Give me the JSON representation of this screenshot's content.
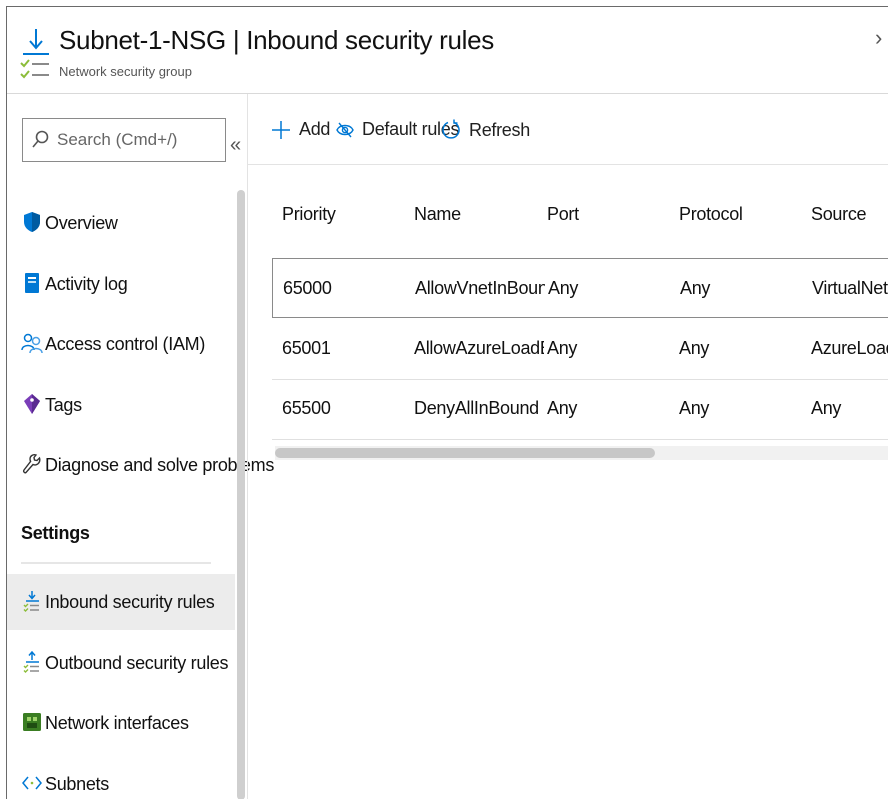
{
  "header": {
    "title": "Subnet-1-NSG | Inbound security rules",
    "subtitle": "Network security group",
    "icon": "inbound-rules-icon",
    "chevron": "›"
  },
  "sidebar": {
    "search_placeholder": "Search (Cmd+/)",
    "collapse_glyph": "«",
    "items": [
      {
        "label": "Overview",
        "icon": "shield-icon"
      },
      {
        "label": "Activity log",
        "icon": "book-icon"
      },
      {
        "label": "Access control (IAM)",
        "icon": "people-icon"
      },
      {
        "label": "Tags",
        "icon": "tag-icon"
      },
      {
        "label": "Diagnose and solve problems",
        "icon": "wrench-icon"
      }
    ],
    "section_title": "Settings",
    "settings_items": [
      {
        "label": "Inbound security rules",
        "icon": "inbound-rules-icon",
        "active": true
      },
      {
        "label": "Outbound security rules",
        "icon": "outbound-rules-icon",
        "active": false
      },
      {
        "label": "Network interfaces",
        "icon": "network-interface-icon",
        "active": false
      },
      {
        "label": "Subnets",
        "icon": "subnet-icon",
        "active": false
      }
    ]
  },
  "toolbar": {
    "add_label": "Add",
    "default_rules_label": "Default rules",
    "refresh_label": "Refresh"
  },
  "table": {
    "columns": [
      "Priority",
      "Name",
      "Port",
      "Protocol",
      "Source"
    ],
    "rows": [
      {
        "priority": "65000",
        "name": "AllowVnetInBound",
        "port": "Any",
        "protocol": "Any",
        "source": "VirtualNetwo"
      },
      {
        "priority": "65001",
        "name": "AllowAzureLoadBala...",
        "port": "Any",
        "protocol": "Any",
        "source": "AzureLoadBa"
      },
      {
        "priority": "65500",
        "name": "DenyAllInBound",
        "port": "Any",
        "protocol": "Any",
        "source": "Any"
      }
    ]
  },
  "colors": {
    "azure_blue": "#0078d4",
    "active_bg": "#ececec",
    "check_green": "#8cbd3a"
  }
}
